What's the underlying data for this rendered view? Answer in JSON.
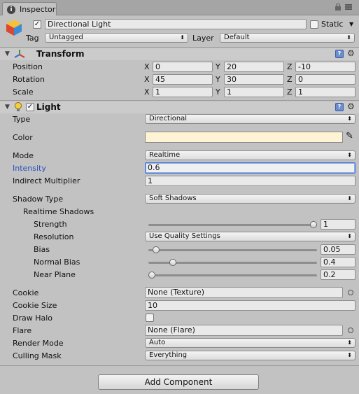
{
  "window": {
    "tab_label": "Inspector",
    "tab_icon": "info-icon"
  },
  "object": {
    "name": "Directional Light",
    "active": true,
    "static_label": "Static",
    "static_checked": false,
    "tag_label": "Tag",
    "tag_value": "Untagged",
    "layer_label": "Layer",
    "layer_value": "Default"
  },
  "transform": {
    "title": "Transform",
    "position_label": "Position",
    "rotation_label": "Rotation",
    "scale_label": "Scale",
    "axis_x": "X",
    "axis_y": "Y",
    "axis_z": "Z",
    "position": {
      "x": "0",
      "y": "20",
      "z": "-10"
    },
    "rotation": {
      "x": "45",
      "y": "30",
      "z": "0"
    },
    "scale": {
      "x": "1",
      "y": "1",
      "z": "1"
    }
  },
  "light": {
    "title": "Light",
    "enabled": true,
    "type_label": "Type",
    "type_value": "Directional",
    "color_label": "Color",
    "color_value": "#fff3d6",
    "mode_label": "Mode",
    "mode_value": "Realtime",
    "intensity_label": "Intensity",
    "intensity_value": "0.6",
    "indirect_label": "Indirect Multiplier",
    "indirect_value": "1",
    "shadow_type_label": "Shadow Type",
    "shadow_type_value": "Soft Shadows",
    "realtime_shadows_label": "Realtime Shadows",
    "strength_label": "Strength",
    "strength_value": "1",
    "strength_level": 1.0,
    "resolution_label": "Resolution",
    "resolution_value": "Use Quality Settings",
    "bias_label": "Bias",
    "bias_value": "0.05",
    "bias_level": 0.025,
    "normal_bias_label": "Normal Bias",
    "normal_bias_value": "0.4",
    "normal_bias_level": 0.13,
    "near_plane_label": "Near Plane",
    "near_plane_value": "0.2",
    "near_plane_level": 0.0,
    "cookie_label": "Cookie",
    "cookie_value": "None (Texture)",
    "cookie_size_label": "Cookie Size",
    "cookie_size_value": "10",
    "draw_halo_label": "Draw Halo",
    "draw_halo_checked": false,
    "flare_label": "Flare",
    "flare_value": "None (Flare)",
    "render_mode_label": "Render Mode",
    "render_mode_value": "Auto",
    "culling_mask_label": "Culling Mask",
    "culling_mask_value": "Everything"
  },
  "footer": {
    "add_component_label": "Add Component"
  },
  "colors": {
    "accent_blue": "#2a50c0",
    "panel_bg": "#c2c2c2"
  }
}
